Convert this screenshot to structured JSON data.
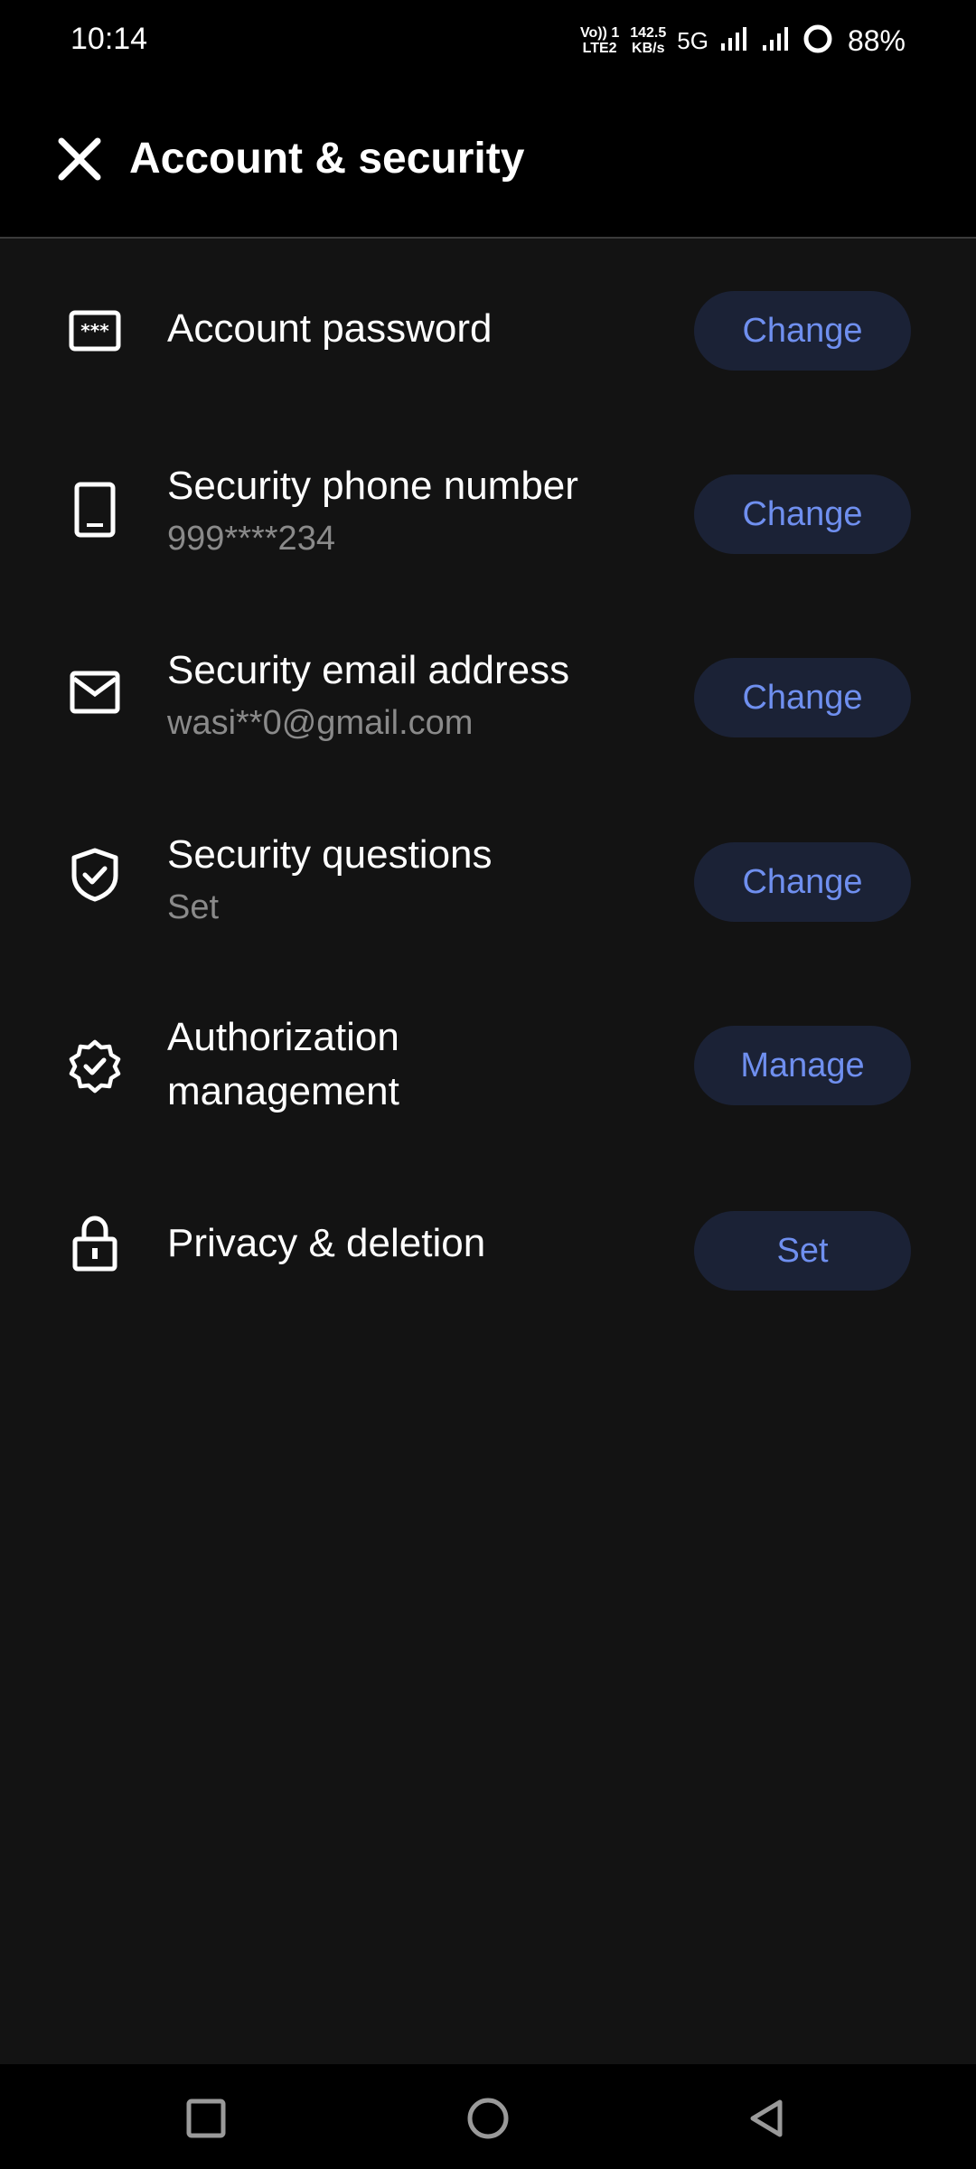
{
  "status_bar": {
    "time": "10:14",
    "network_line1": "Vo)) 1",
    "network_line2": "LTE2",
    "speed_value": "142.5",
    "speed_unit": "KB/s",
    "network_type": "5G",
    "battery": "88%"
  },
  "header": {
    "title": "Account & security",
    "close_icon": "close-icon"
  },
  "rows": [
    {
      "icon": "password-icon",
      "title": "Account password",
      "subtitle": "",
      "button": "Change"
    },
    {
      "icon": "phone-icon",
      "title": "Security phone number",
      "subtitle": "999****234",
      "button": "Change"
    },
    {
      "icon": "email-icon",
      "title": "Security email address",
      "subtitle": "wasi**0@gmail.com",
      "button": "Change"
    },
    {
      "icon": "shield-check-icon",
      "title": "Security questions",
      "subtitle": "Set",
      "button": "Change"
    },
    {
      "icon": "verified-badge-icon",
      "title": "Authorization management",
      "subtitle": "",
      "button": "Manage"
    },
    {
      "icon": "lock-icon",
      "title": "Privacy & deletion",
      "subtitle": "",
      "button": "Set"
    }
  ],
  "colors": {
    "background": "#131313",
    "header": "#000000",
    "button_bg": "#1b2236",
    "button_text": "#6f8fef",
    "subtitle": "#8a8a8a"
  },
  "nav_bar": {
    "recents_icon": "square-icon",
    "home_icon": "circle-icon",
    "back_icon": "triangle-back-icon"
  }
}
